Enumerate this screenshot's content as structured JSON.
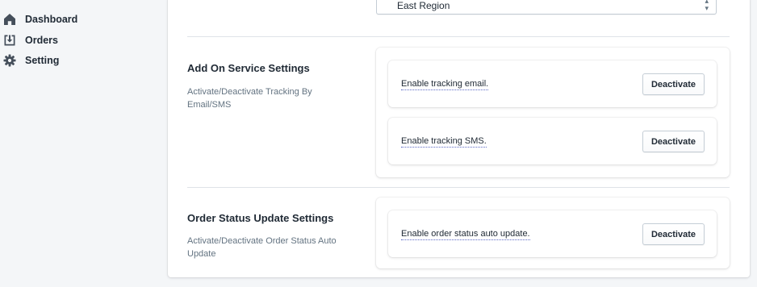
{
  "sidebar": {
    "items": [
      {
        "label": "Dashboard",
        "icon": "home-icon"
      },
      {
        "label": "Orders",
        "icon": "orders-download-icon"
      },
      {
        "label": "Setting",
        "icon": "gear-icon"
      }
    ]
  },
  "region_select": {
    "value": "East Region"
  },
  "sections": {
    "add_on": {
      "title": "Add On Service Settings",
      "description": "Activate/Deactivate Tracking By Email/SMS",
      "rows": [
        {
          "label": "Enable tracking email.",
          "button": "Deactivate"
        },
        {
          "label": "Enable tracking SMS.",
          "button": "Deactivate"
        }
      ]
    },
    "order_status": {
      "title": "Order Status Update Settings",
      "description": "Activate/Deactivate Order Status Auto Update",
      "rows": [
        {
          "label": "Enable order status auto update.",
          "button": "Deactivate"
        }
      ]
    }
  },
  "colors": {
    "background": "#f4f6f8",
    "card": "#ffffff",
    "text": "#212b36",
    "muted_text": "#637381",
    "border": "#c4cdd5",
    "underline": "#5c6ac4"
  }
}
